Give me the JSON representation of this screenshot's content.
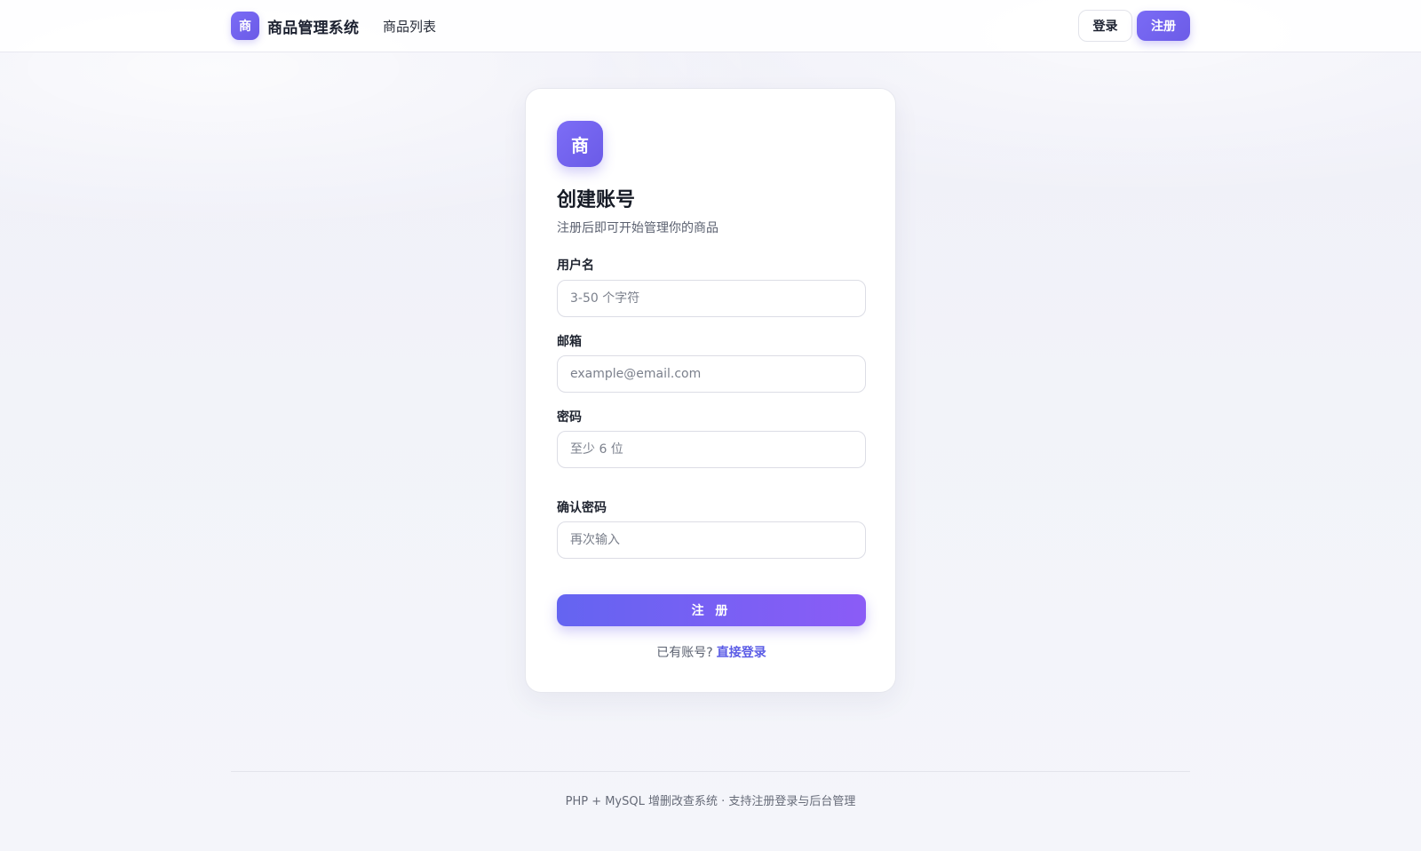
{
  "header": {
    "brand_logo_char": "商",
    "brand_name": "商品管理系统",
    "nav_product_list": "商品列表",
    "login_label": "登录",
    "register_label": "注册"
  },
  "card": {
    "logo_char": "商",
    "title": "创建账号",
    "subtitle": "注册后即可开始管理你的商品",
    "fields": {
      "username": {
        "label": "用户名",
        "placeholder": "3-50 个字符",
        "value": ""
      },
      "email": {
        "label": "邮箱",
        "placeholder": "example@email.com",
        "value": ""
      },
      "password": {
        "label": "密码",
        "placeholder": "至少 6 位",
        "value": ""
      },
      "confirm_password": {
        "label": "确认密码",
        "placeholder": "再次输入",
        "value": ""
      }
    },
    "submit_label": "注 册",
    "login_prompt": "已有账号?",
    "login_link": "直接登录"
  },
  "footer": {
    "text": "PHP + MySQL 增删改查系统 · 支持注册登录与后台管理"
  },
  "colors": {
    "accent": "#6c5ce7",
    "accent_gradient_start": "#6464f1",
    "accent_gradient_end": "#8b5cf6",
    "link": "#5b5ce6",
    "background": "#f2f3f9"
  }
}
